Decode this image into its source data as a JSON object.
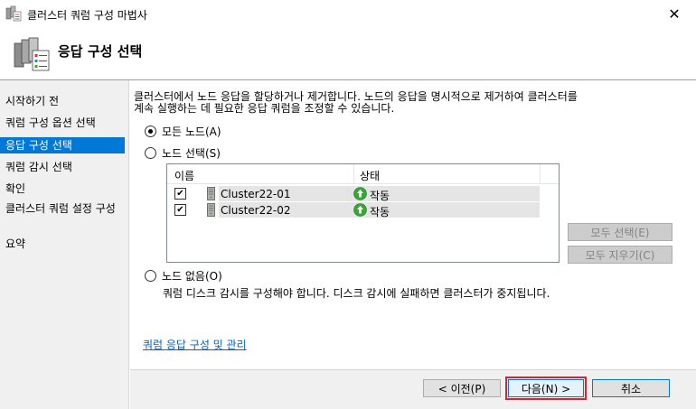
{
  "window": {
    "title": "클러스터 쿼럼 구성 마법사",
    "close_glyph": "✕"
  },
  "header": {
    "title": "응답 구성 선택"
  },
  "nav": {
    "items": [
      {
        "label": "시작하기 전",
        "selected": false
      },
      {
        "label": "쿼럼 구성 옵션 선택",
        "selected": false
      },
      {
        "label": "응답 구성 선택",
        "selected": true
      },
      {
        "label": "쿼럼 감시 선택",
        "selected": false
      },
      {
        "label": "확인",
        "selected": false
      },
      {
        "label": "클러스터 쿼럼 설정 구성",
        "selected": false
      },
      {
        "label": "요약",
        "selected": false
      }
    ]
  },
  "main": {
    "description_line1": "클러스터에서 노드 응답을 할당하거나 제거합니다. 노드의 응답을 명시적으로 제거하여 클러스터를",
    "description_line2": "계속 실행하는 데 필요한 응답 쿼럼을 조정할 수 있습니다.",
    "options": {
      "all_nodes": {
        "label": "모든 노드(A)",
        "checked": true
      },
      "select_nodes": {
        "label": "노드 선택(S)",
        "checked": false
      },
      "no_nodes": {
        "label": "노드 없음(O)",
        "checked": false
      }
    },
    "node_list": {
      "columns": {
        "name": "이름",
        "status": "상태"
      },
      "rows": [
        {
          "checked": true,
          "name": "Cluster22-01",
          "status": "작동",
          "status_icon": "green-up-arrow-icon"
        },
        {
          "checked": true,
          "name": "Cluster22-02",
          "status": "작동",
          "status_icon": "green-up-arrow-icon"
        }
      ]
    },
    "select_all_label": "모두 선택(E)",
    "clear_all_label": "모두 지우기(C)",
    "no_nodes_note": "쿼럼 디스크 감시를 구성해야 합니다. 디스크 감시에 실패하면 클러스터가 중지됩니다.",
    "help_link": "쿼럼 응답 구성 및 관리"
  },
  "footer": {
    "prev_label": "< 이전(P)",
    "next_label": "다음(N) >",
    "cancel_label": "취소"
  },
  "colors": {
    "selection": "#0078d7",
    "link": "#0066cc",
    "highlight_box": "#e0202a",
    "status_ok": "#3aa43a"
  }
}
